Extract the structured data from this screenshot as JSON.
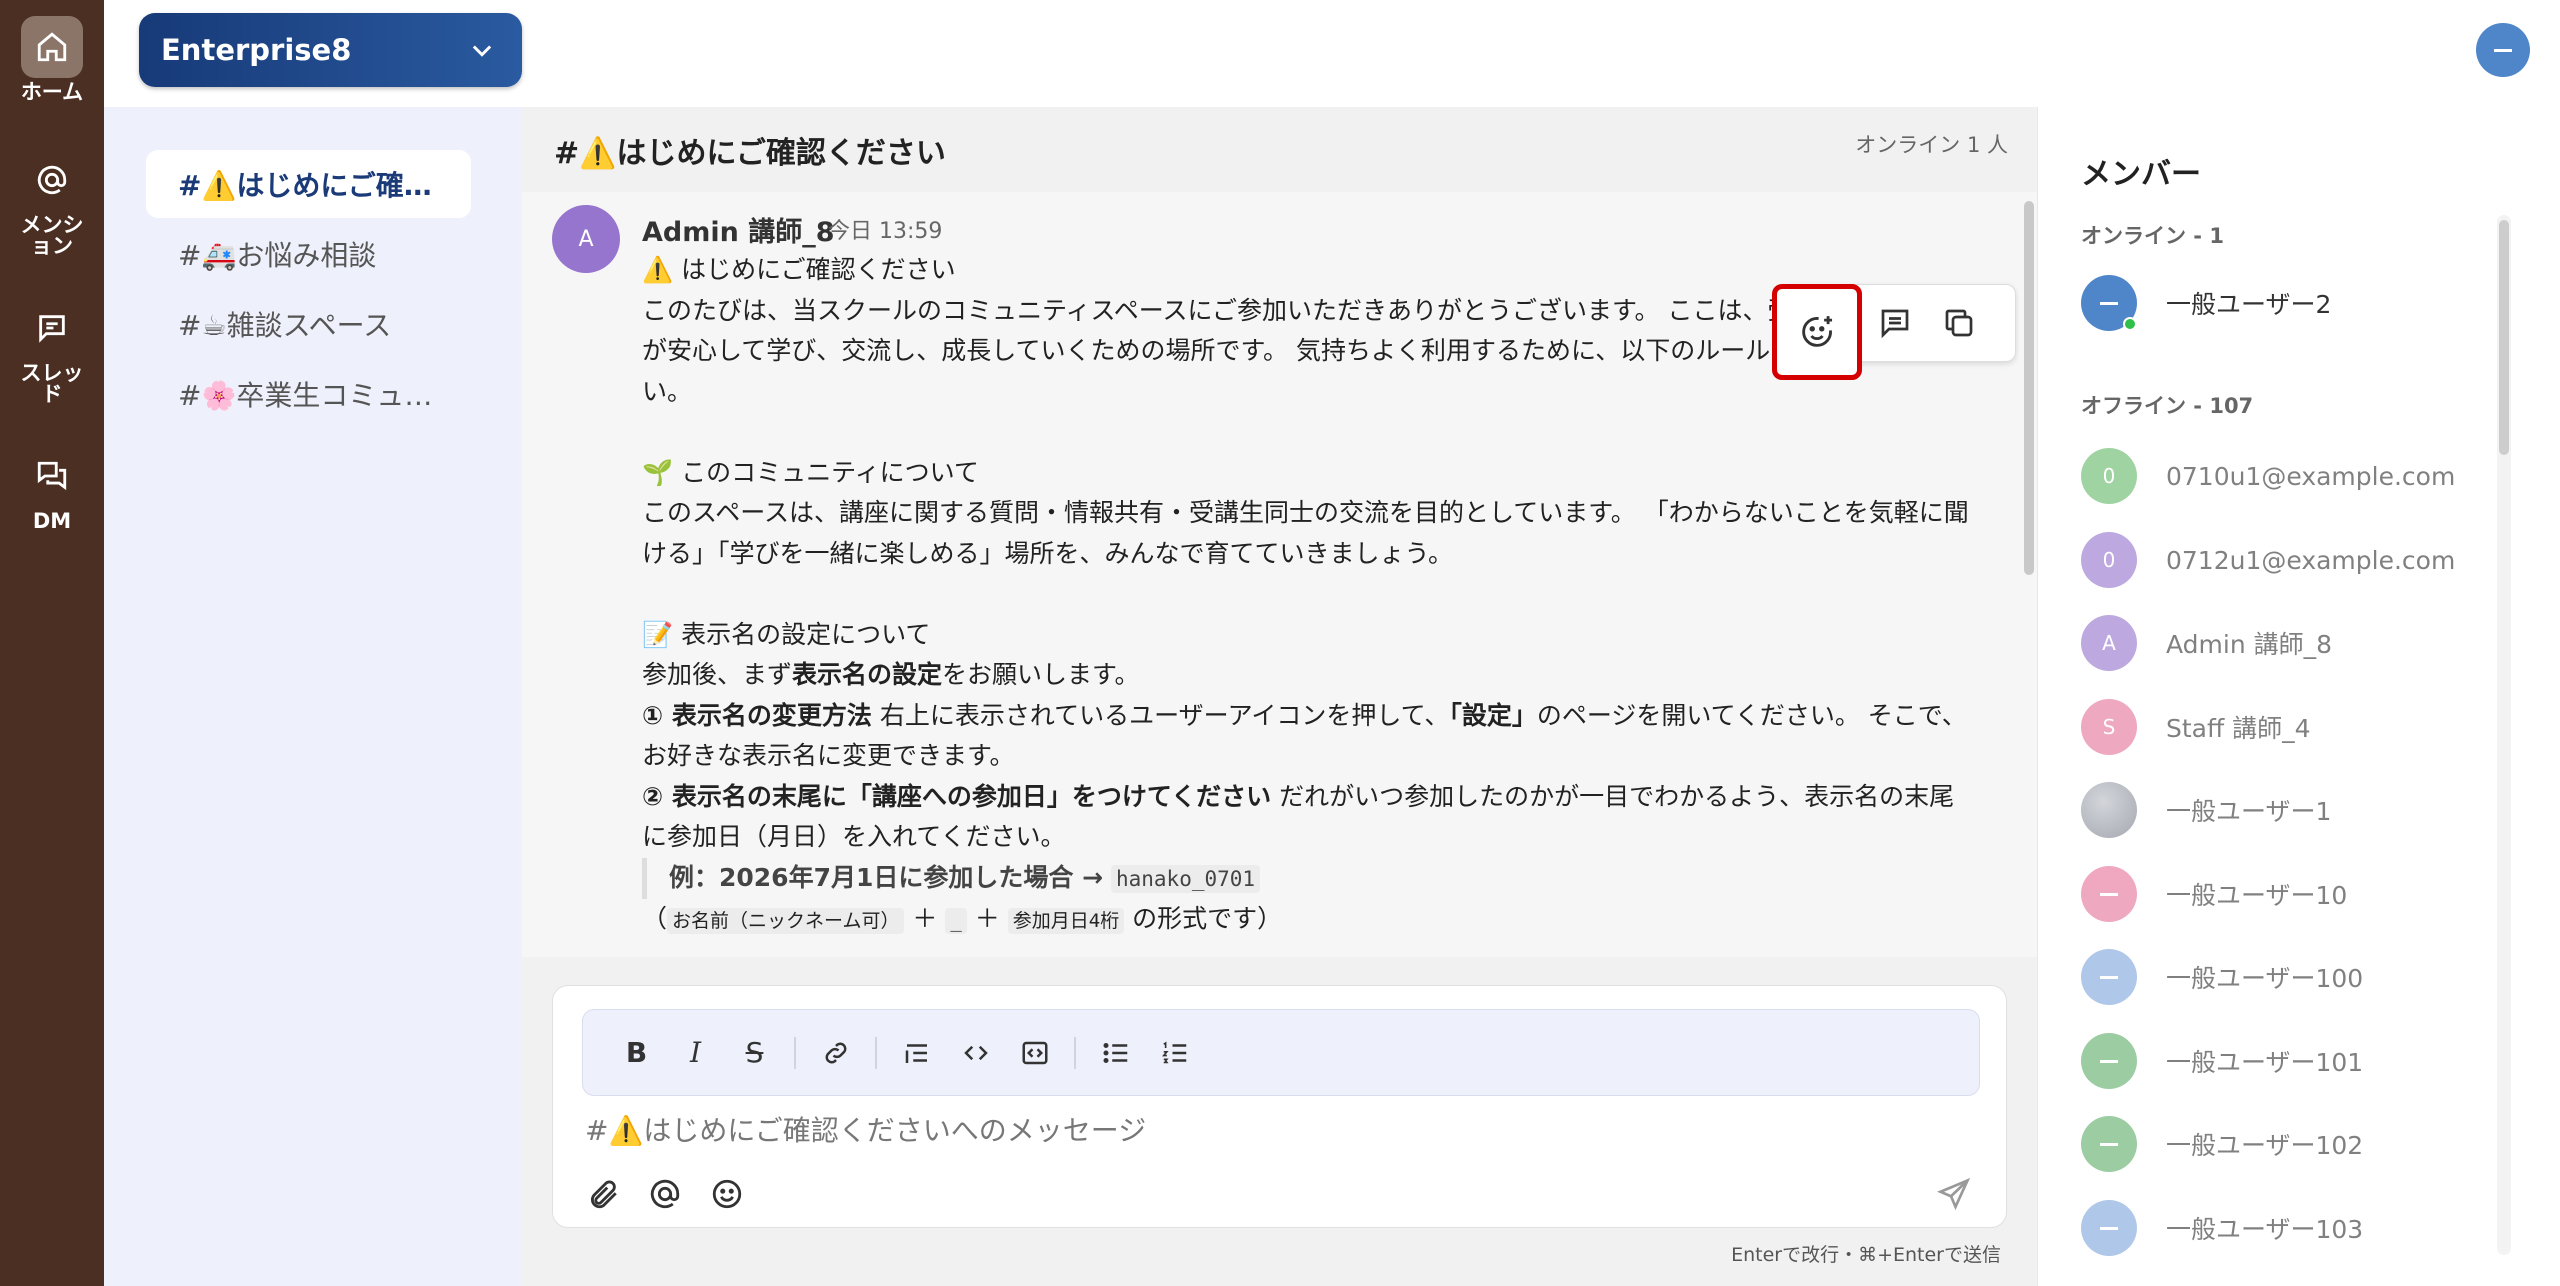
{
  "rail": [
    {
      "icon": "home-icon",
      "label": "ホーム",
      "active": true
    },
    {
      "icon": "at-sign-icon",
      "label": "メンション",
      "active": false
    },
    {
      "icon": "thread-icon",
      "label": "スレッド",
      "active": false
    },
    {
      "icon": "dm-icon",
      "label": "DM",
      "active": false
    }
  ],
  "workspace": {
    "name": "Enterprise8"
  },
  "channels": [
    {
      "label": "#⚠️はじめにご確…",
      "active": true
    },
    {
      "label": "#🚑お悩み相談",
      "active": false
    },
    {
      "label": "#☕雑談スペース",
      "active": false
    },
    {
      "label": "#🌸卒業生コミュ…",
      "active": false
    }
  ],
  "header": {
    "title": "#⚠️はじめにご確認ください",
    "online": "オンライン 1 人"
  },
  "message": {
    "avatar_initial": "A",
    "author": "Admin 講師_8",
    "time": "今日 13:59",
    "line1": "⚠️ はじめにご確認ください",
    "line2": "このたびは、当スクールのコミュニティスペースにご参加いただきありがとうございます。 ここは、受講生のみなさんが安心して学び、交流し、成長していくための場所です。 気持ちよく利用するために、以下のルールをご一読ください。",
    "section2_title": "🌱 このコミュニティについて",
    "section2_body": "このスペースは、講座に関する質問・情報共有・受講生同士の交流を目的としています。 「わからないことを気軽に聞ける」「学びを一緒に楽しめる」場所を、みんなで育てていきましょう。",
    "section3_title": "📝 表示名の設定について",
    "s3_pre": "参加後、まず",
    "s3_bold": "表示名の設定",
    "s3_post": "をお願いします。",
    "rule1_bold": "① 表示名の変更方法",
    "rule1_a": " 右上に表示されているユーザーアイコンを押して、",
    "rule1_b": "「設定」",
    "rule1_c": "のページを開いてください。 そこで、お好きな表示名に変更できます。",
    "rule2_bold": "② 表示名の末尾に「講座への参加日」をつけてください",
    "rule2_text": " だれがいつ参加したのかが一目でわかるよう、表示名の末尾に参加日（月日）を入れてください。",
    "example_label": "例：2026年7月1日に参加した場合 →",
    "example_code": "hanako_0701",
    "fmt_open": "（",
    "fmt_name": "お名前（ニックネーム可）",
    "fmt_plus1": "＋",
    "fmt_underscore": "_",
    "fmt_plus2": "＋",
    "fmt_date": "参加月日4桁",
    "fmt_close": "の形式です）"
  },
  "actions": {
    "reaction": "add-reaction-icon",
    "thread": "reply-thread-icon",
    "copy": "copy-icon"
  },
  "composer": {
    "placeholder": "#⚠️はじめにご確認くださいへのメッセージ",
    "hint": "Enterで改行・⌘+Enterで送信",
    "format": [
      "B",
      "I",
      "S"
    ]
  },
  "members": {
    "title": "メンバー",
    "online_label": "オンライン - 1",
    "offline_label": "オフライン - 107",
    "online": [
      {
        "name": "一般ユーザー2",
        "initial": "",
        "color": "#4f86c9"
      }
    ],
    "offline": [
      {
        "name": "0710u1@example.com",
        "initial": "0",
        "color": "#66bb6a"
      },
      {
        "name": "0712u1@example.com",
        "initial": "0",
        "color": "#9575cd"
      },
      {
        "name": "Admin 講師_8",
        "initial": "A",
        "color": "#9575cd"
      },
      {
        "name": "Staff 講師_4",
        "initial": "S",
        "color": "#e57399"
      },
      {
        "name": "一般ユーザー1",
        "initial": "",
        "color": "#8a8f99"
      },
      {
        "name": "一般ユーザー10",
        "initial": "",
        "color": "#e57399"
      },
      {
        "name": "一般ユーザー100",
        "initial": "",
        "color": "#7fa7dc"
      },
      {
        "name": "一般ユーザー101",
        "initial": "",
        "color": "#5fae6a"
      },
      {
        "name": "一般ユーザー102",
        "initial": "",
        "color": "#5fae6a"
      },
      {
        "name": "一般ユーザー103",
        "initial": "",
        "color": "#7fa7dc"
      }
    ]
  }
}
